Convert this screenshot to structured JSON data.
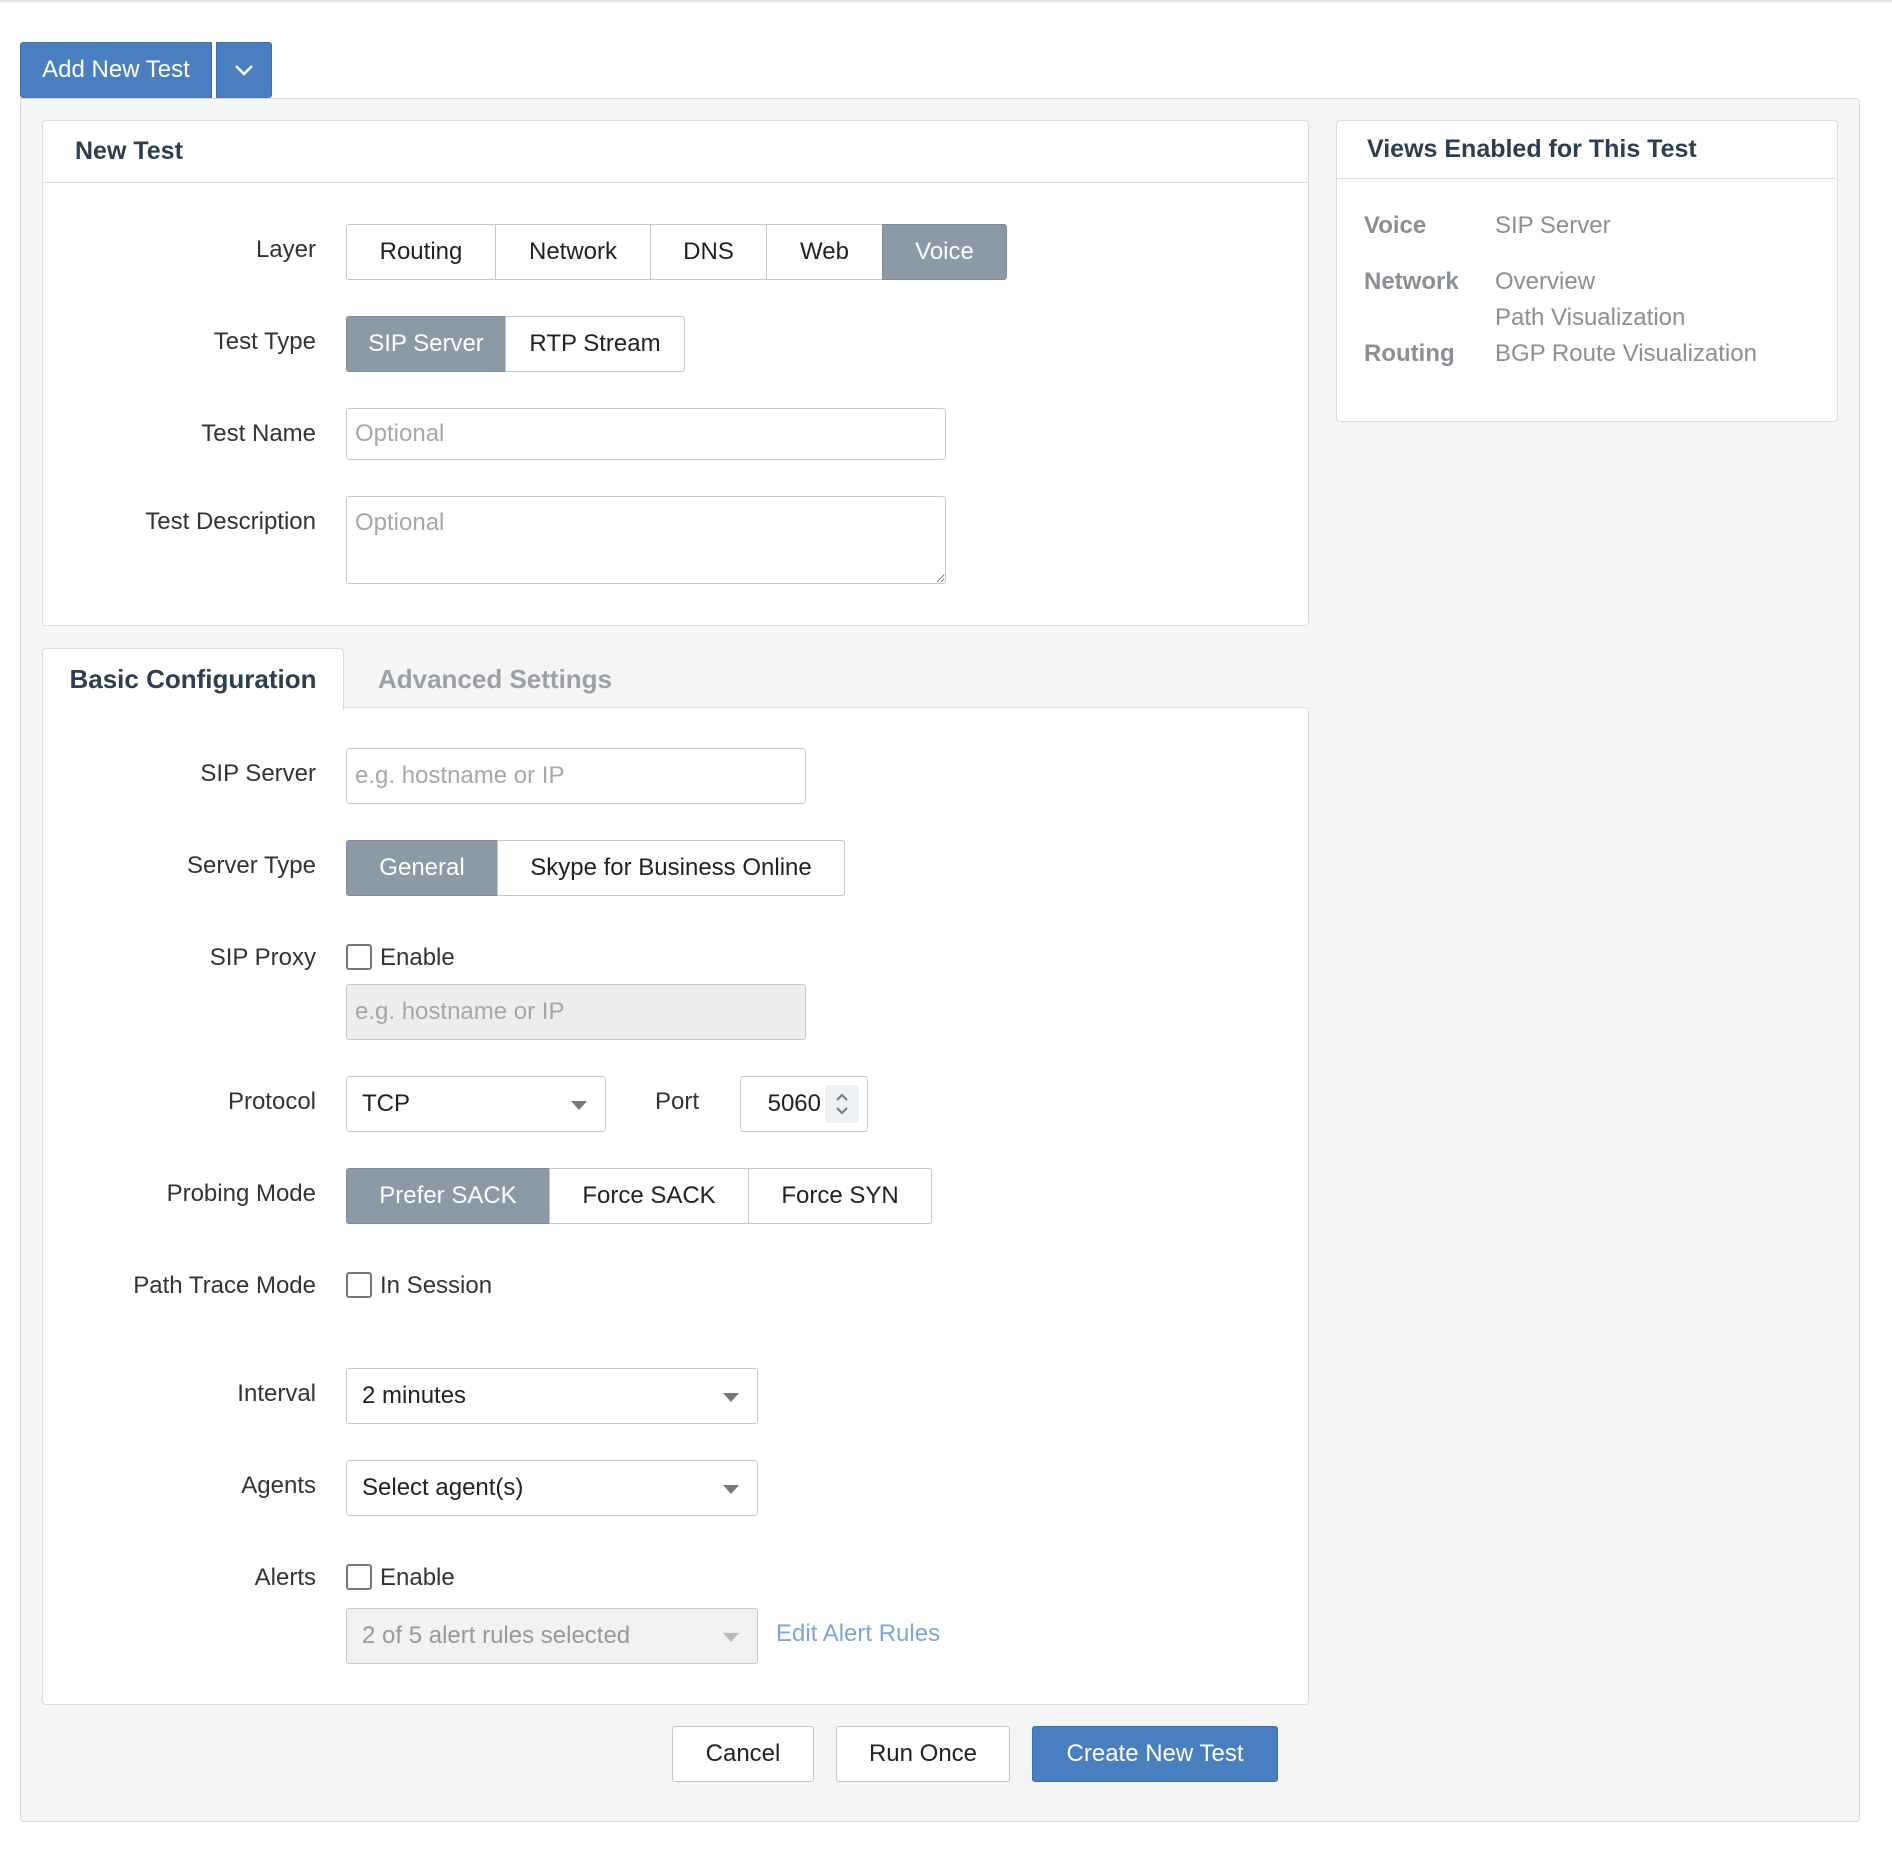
{
  "header": {
    "add_new_test": "Add New Test",
    "dropdown_icon": "chevron-down-icon"
  },
  "new_test": {
    "title": "New Test",
    "layer_label": "Layer",
    "layers": [
      "Routing",
      "Network",
      "DNS",
      "Web",
      "Voice"
    ],
    "layer_selected": "Voice",
    "test_type_label": "Test Type",
    "test_types": [
      "SIP Server",
      "RTP Stream"
    ],
    "test_type_selected": "SIP Server",
    "test_name_label": "Test Name",
    "test_name_placeholder": "Optional",
    "test_description_label": "Test Description",
    "test_description_placeholder": "Optional"
  },
  "views": {
    "title": "Views Enabled for This Test",
    "rows": [
      {
        "key": "Voice",
        "values": [
          "SIP Server"
        ]
      },
      {
        "key": "Network",
        "values": [
          "Overview",
          "Path Visualization"
        ]
      },
      {
        "key": "Routing",
        "values": [
          "BGP Route Visualization"
        ]
      }
    ]
  },
  "tabs": {
    "basic": "Basic Configuration",
    "advanced": "Advanced Settings",
    "active": "Basic Configuration"
  },
  "basic": {
    "sip_server_label": "SIP Server",
    "sip_server_placeholder": "e.g. hostname or IP",
    "server_type_label": "Server Type",
    "server_types": [
      "General",
      "Skype for Business Online"
    ],
    "server_type_selected": "General",
    "sip_proxy_label": "SIP Proxy",
    "sip_proxy_checkbox": "Enable",
    "sip_proxy_checked": false,
    "sip_proxy_placeholder": "e.g. hostname or IP",
    "protocol_label": "Protocol",
    "protocol_value": "TCP",
    "port_label": "Port",
    "port_value": "5060",
    "probing_mode_label": "Probing Mode",
    "probing_modes": [
      "Prefer SACK",
      "Force SACK",
      "Force SYN"
    ],
    "probing_mode_selected": "Prefer SACK",
    "path_trace_label": "Path Trace Mode",
    "path_trace_checkbox": "In Session",
    "path_trace_checked": false,
    "interval_label": "Interval",
    "interval_value": "2 minutes",
    "agents_label": "Agents",
    "agents_value": "Select agent(s)",
    "alerts_label": "Alerts",
    "alerts_checkbox": "Enable",
    "alerts_checked": false,
    "alert_rules_value": "2 of 5 alert rules selected",
    "edit_alert_rules": "Edit Alert Rules"
  },
  "footer": {
    "cancel": "Cancel",
    "run_once": "Run Once",
    "create": "Create New Test"
  },
  "colors": {
    "primary": "#4a7fbf",
    "active_segment": "#8c9aa7",
    "link": "#7fa6cf"
  }
}
